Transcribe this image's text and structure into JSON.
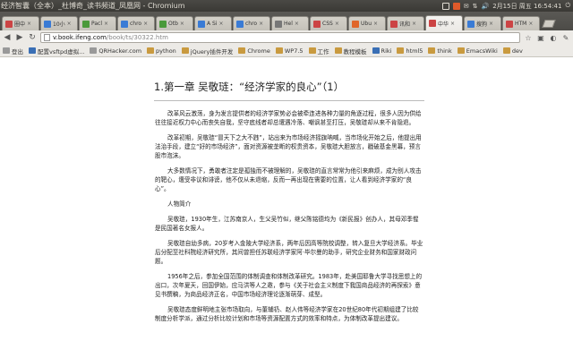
{
  "panel": {
    "window_title": "经济智囊（全本）_杜博奇_读书频道_凤凰网 - Chromium",
    "indicators": [
      "✉",
      "⇅",
      "🔊"
    ],
    "date_time": "2月15日 周五 16:54:41"
  },
  "tabs": [
    {
      "label": "圈中",
      "color": "#c44",
      "active": false
    },
    {
      "label": "10小",
      "color": "#3a7bd5",
      "active": false
    },
    {
      "label": "Pacl",
      "color": "#4a9a3a",
      "active": false
    },
    {
      "label": "chro",
      "color": "#3a7bd5",
      "active": false
    },
    {
      "label": "Otb",
      "color": "#4a9a3a",
      "active": false
    },
    {
      "label": "A Si",
      "color": "#3a7bd5",
      "active": false
    },
    {
      "label": "chro",
      "color": "#3a7bd5",
      "active": false
    },
    {
      "label": "Hel",
      "color": "#777",
      "active": false
    },
    {
      "label": "CSS",
      "color": "#c44",
      "active": false
    },
    {
      "label": "Ubu",
      "color": "#e0662b",
      "active": false
    },
    {
      "label": "讯和",
      "color": "#c44",
      "active": false
    },
    {
      "label": "中华",
      "color": "#c44",
      "active": true
    },
    {
      "label": "搜狗",
      "color": "#3a7bd5",
      "active": false
    },
    {
      "label": "HTM",
      "color": "#c44",
      "active": false
    }
  ],
  "toolbar": {
    "back_icon": "back-arrow-icon",
    "forward_icon": "forward-arrow-icon",
    "reload_icon": "reload-icon",
    "url_host": "v.book.ifeng.com",
    "url_path": "/book/ts/30322.htm"
  },
  "bookmarks": [
    {
      "label": "登出",
      "icon": "grey"
    },
    {
      "label": "配置vsftpd虚拟...",
      "icon": "blue"
    },
    {
      "label": "QRHacker.com",
      "icon": "grey"
    },
    {
      "label": "python",
      "icon": "folder"
    },
    {
      "label": "jQuery插件开发",
      "icon": "folder"
    },
    {
      "label": "Chrome",
      "icon": "folder"
    },
    {
      "label": "WP7.5",
      "icon": "folder"
    },
    {
      "label": "工作",
      "icon": "folder"
    },
    {
      "label": "教程模板",
      "icon": "folder"
    },
    {
      "label": "Riki",
      "icon": "blue"
    },
    {
      "label": "html5",
      "icon": "folder"
    },
    {
      "label": "think",
      "icon": "folder"
    },
    {
      "label": "EmacsWiki",
      "icon": "folder"
    },
    {
      "label": "dev",
      "icon": "folder"
    }
  ],
  "article": {
    "title": "1.第一章 吴敬琏：“经济学家的良心”（1）",
    "paragraphs": [
      "改革风云激荡，身为发言提供者的经济学家势必会被牵连进各种力量的角逐过程，很多人因为供给往往接近权力中心而丧失自我，坚守底线者却总遭遇冷落、嘲讽甚至打压，吴敬琏却从来不肯隐退。",
      "改革初期，吴敬琏“冒天下之大不韪”，站出来为市场经济摇旗呐喊，当市场化开始之后，他提出用法治手段，建立“好的市场经济”，面对资源被垄断的权贵资本，吴敬琏大胆放言，戳破基金黑幕，预言股市泡沫。",
      "大多数情况下，勇敢者注定是孤独而不被理解的，吴敬琏的直言常常为他引来麻烦，成为别人攻击的靶心，遭受非议和诽谤，他不仅从未退缩，反而一再出现在需要的位置，让人看到经济学家的“良心”。",
      "人物简介",
      "吴敬琏，1930年生，江苏南京人，生父吴竹似，继父陈铭德均为《新民报》创办人，其母邓季惺是民国著名女报人。",
      "吴敬琏自幼多病，20岁考入金陵大学经济系，两年后因高等院校调整，转入复旦大学经济系。毕业后分配至社科院经济研究所，其间曾担任苏联经济学家阿·毕尔曼的助手，研究企业财务和国家财政问题。",
      "1956年之后，参加全国范围的体制调查和体制改革研究。1983年，赴美国耶鲁大学寻找思想上的出口，次年夏天，回国伊始，应马洪等人之邀，参与《关于社会主义制度下我国商品经济的再探索》意见书撰稿，为商品经济正名，中国市场经济理论逐渐萌芽、成型。",
      "吴敬琏态度鲜明地主张市场取向，与董辅礽、赵人伟等经济学家在20世纪80年代初期组建了比较制度分析学派，通过分析比较计划和市场等资源配置方式的效率和特点，为体制改革提出建议。"
    ]
  }
}
